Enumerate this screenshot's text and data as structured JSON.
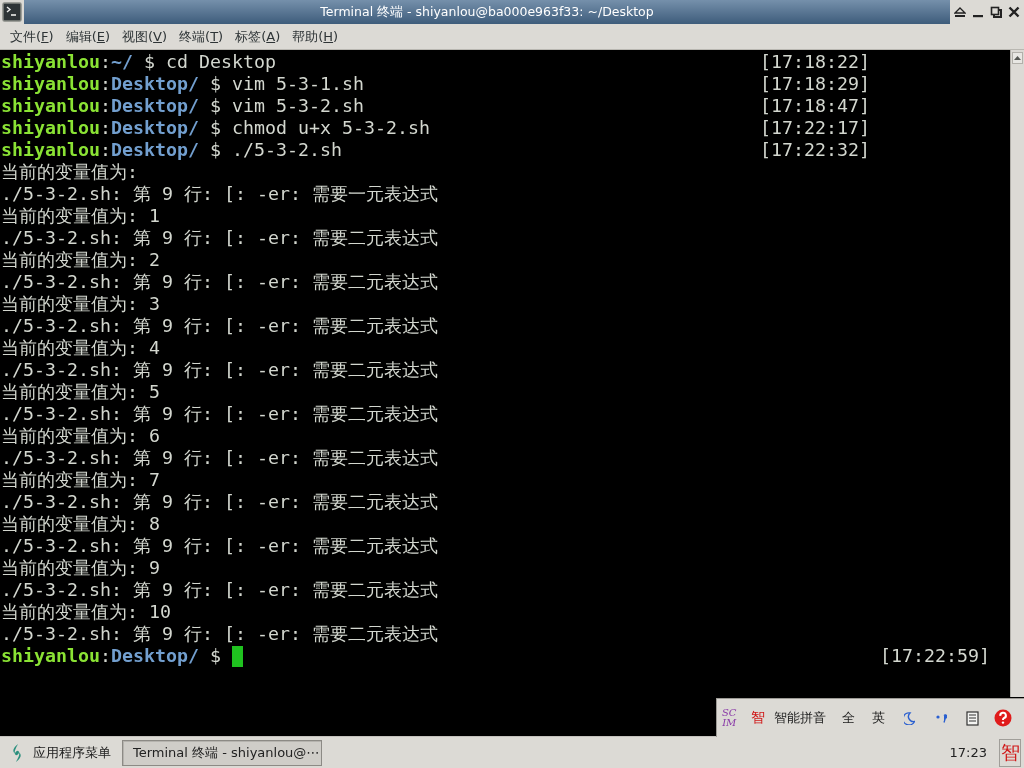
{
  "window": {
    "title": "Terminal 终端 - shiyanlou@ba000e963f33: ~/Desktop"
  },
  "menu": [
    {
      "prefix": "文件(",
      "accel": "F",
      "suffix": ")"
    },
    {
      "prefix": "编辑(",
      "accel": "E",
      "suffix": ")"
    },
    {
      "prefix": "视图(",
      "accel": "V",
      "suffix": ")"
    },
    {
      "prefix": "终端(",
      "accel": "T",
      "suffix": ")"
    },
    {
      "prefix": "标签(",
      "accel": "A",
      "suffix": ")"
    },
    {
      "prefix": "帮助(",
      "accel": "H",
      "suffix": ")"
    }
  ],
  "terminal": {
    "lines": [
      {
        "kind": "prompt",
        "user": "shiyanlou",
        "separator": ":",
        "path": "~/",
        "symbol": "$",
        "command": "cd Desktop",
        "time": "[17:18:22]",
        "cursor": false
      },
      {
        "kind": "prompt",
        "user": "shiyanlou",
        "separator": ":",
        "path": "Desktop/",
        "symbol": "$",
        "command": "vim 5-3-1.sh",
        "time": "[17:18:29]",
        "cursor": false
      },
      {
        "kind": "prompt",
        "user": "shiyanlou",
        "separator": ":",
        "path": "Desktop/",
        "symbol": "$",
        "command": "vim 5-3-2.sh",
        "time": "[17:18:47]",
        "cursor": false
      },
      {
        "kind": "prompt",
        "user": "shiyanlou",
        "separator": ":",
        "path": "Desktop/",
        "symbol": "$",
        "command": "chmod u+x 5-3-2.sh",
        "time": "[17:22:17]",
        "cursor": false
      },
      {
        "kind": "prompt",
        "user": "shiyanlou",
        "separator": ":",
        "path": "Desktop/",
        "symbol": "$",
        "command": "./5-3-2.sh",
        "time": "[17:22:32]",
        "cursor": false
      },
      {
        "kind": "output",
        "text": "当前的变量值为:"
      },
      {
        "kind": "output",
        "text": "./5-3-2.sh: 第 9 行: [: -er: 需要一元表达式"
      },
      {
        "kind": "output",
        "text": "当前的变量值为: 1"
      },
      {
        "kind": "output",
        "text": "./5-3-2.sh: 第 9 行: [: -er: 需要二元表达式"
      },
      {
        "kind": "output",
        "text": "当前的变量值为: 2"
      },
      {
        "kind": "output",
        "text": "./5-3-2.sh: 第 9 行: [: -er: 需要二元表达式"
      },
      {
        "kind": "output",
        "text": "当前的变量值为: 3"
      },
      {
        "kind": "output",
        "text": "./5-3-2.sh: 第 9 行: [: -er: 需要二元表达式"
      },
      {
        "kind": "output",
        "text": "当前的变量值为: 4"
      },
      {
        "kind": "output",
        "text": "./5-3-2.sh: 第 9 行: [: -er: 需要二元表达式"
      },
      {
        "kind": "output",
        "text": "当前的变量值为: 5"
      },
      {
        "kind": "output",
        "text": "./5-3-2.sh: 第 9 行: [: -er: 需要二元表达式"
      },
      {
        "kind": "output",
        "text": "当前的变量值为: 6"
      },
      {
        "kind": "output",
        "text": "./5-3-2.sh: 第 9 行: [: -er: 需要二元表达式"
      },
      {
        "kind": "output",
        "text": "当前的变量值为: 7"
      },
      {
        "kind": "output",
        "text": "./5-3-2.sh: 第 9 行: [: -er: 需要二元表达式"
      },
      {
        "kind": "output",
        "text": "当前的变量值为: 8"
      },
      {
        "kind": "output",
        "text": "./5-3-2.sh: 第 9 行: [: -er: 需要二元表达式"
      },
      {
        "kind": "output",
        "text": "当前的变量值为: 9"
      },
      {
        "kind": "output",
        "text": "./5-3-2.sh: 第 9 行: [: -er: 需要二元表达式"
      },
      {
        "kind": "output",
        "text": "当前的变量值为: 10"
      },
      {
        "kind": "output",
        "text": "./5-3-2.sh: 第 9 行: [: -er: 需要二元表达式"
      },
      {
        "kind": "prompt",
        "user": "shiyanlou",
        "separator": ":",
        "path": "Desktop/",
        "symbol": "$",
        "time": "[17:22:59]",
        "cursor": true
      }
    ]
  },
  "ime_bar": {
    "logo": [
      "SC",
      "IM"
    ],
    "mode": "智",
    "method": "智能拼音",
    "width_mode": "全",
    "language": "英"
  },
  "taskbar": {
    "app_menu": "应用程序菜单",
    "tasks": [
      {
        "label": "Terminal 终端 - shiyanlou@⋯",
        "selected": true
      }
    ],
    "clock": "17:23",
    "tray_ime": "智"
  }
}
